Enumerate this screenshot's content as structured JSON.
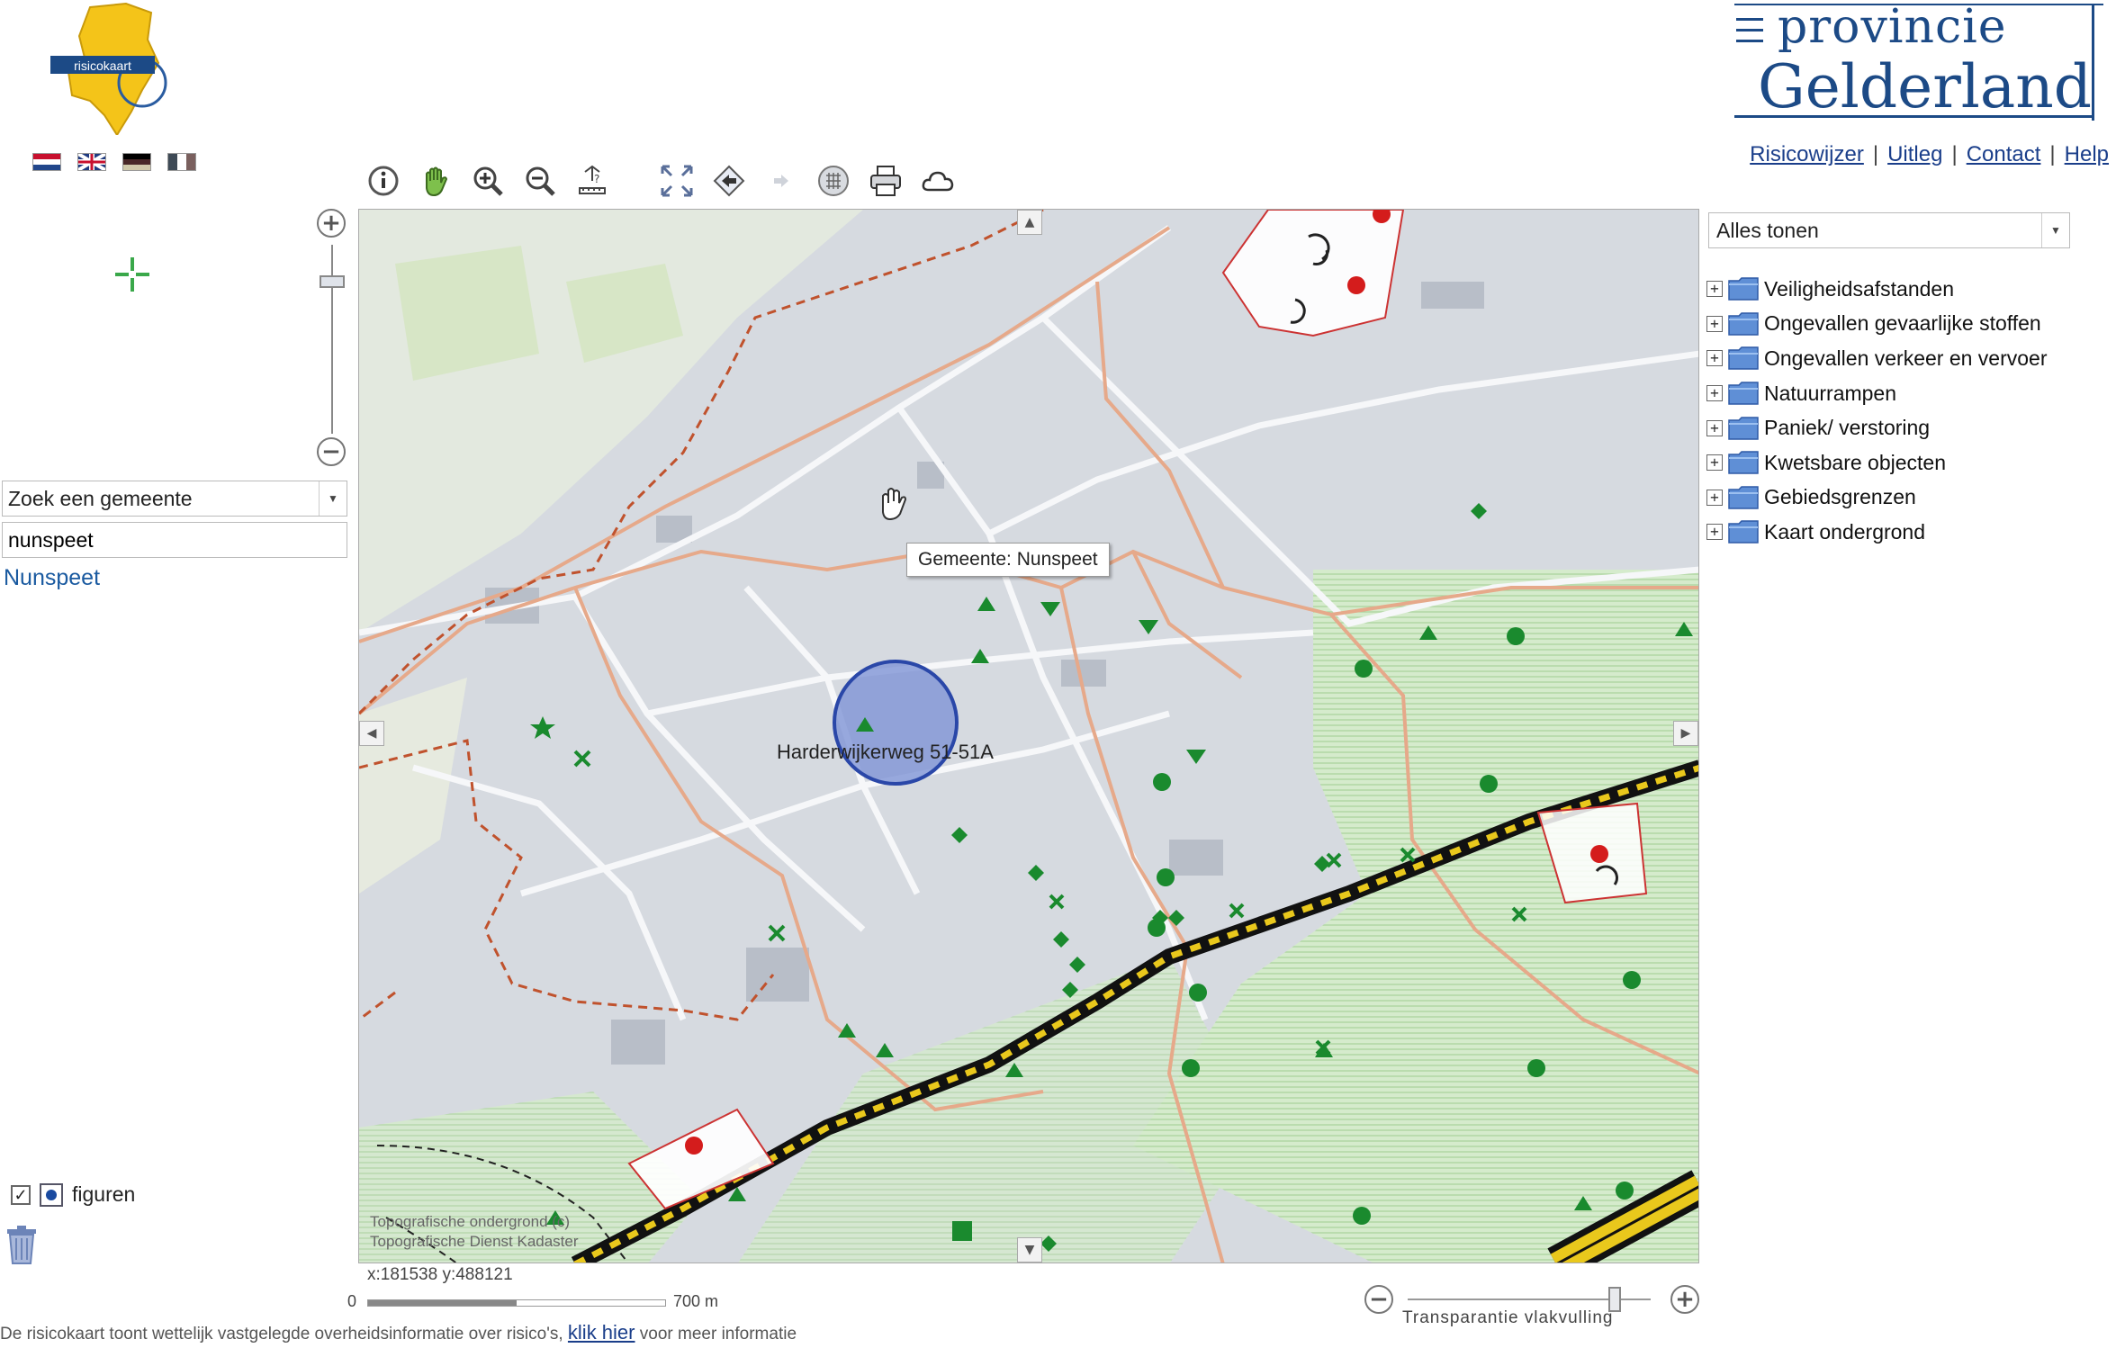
{
  "header": {
    "logo_text": "risicokaart",
    "brand_line1": "provincie",
    "brand_line2": "Gelderland",
    "links": [
      "Risicowijzer",
      "Uitleg",
      "Contact",
      "Help"
    ],
    "language_flags": [
      "nl-flag-icon",
      "en-flag-icon",
      "de-flag-icon",
      "fr-flag-icon"
    ]
  },
  "toolbar": {
    "tools": [
      "info-icon",
      "pan-hand-icon",
      "zoom-in-icon",
      "zoom-out-icon",
      "measure-icon",
      "full-extent-icon",
      "back-arrow-icon",
      "forward-arrow-icon",
      "grid-icon",
      "print-icon",
      "cloud-icon"
    ]
  },
  "left_panel": {
    "zoom_in": "+",
    "zoom_out": "−",
    "gemeente_select": "Zoek een gemeente",
    "search_value": "nunspeet",
    "result": "Nunspeet",
    "figuren_label": "figuren"
  },
  "map": {
    "tooltip": "Gemeente: Nunspeet",
    "address_label": "Harderwijkerweg 51-51A",
    "attribution_line1": "Topografische ondergrond (c)",
    "attribution_line2": "Topografische Dienst Kadaster",
    "coordinates": "x:181538 y:488121",
    "scale_start": "0",
    "scale_end": "700 m",
    "colors": {
      "marker_green": "#1a8a2e",
      "risk_red": "#d41c1c",
      "municipal_border": "#c0522d",
      "highlight_circle": "#7f94d6"
    }
  },
  "transparency": {
    "label": "Transparantie vlakvulling",
    "minus": "−",
    "plus": "+",
    "level": 0.85
  },
  "layers": {
    "select": "Alles tonen",
    "items": [
      "Veiligheidsafstanden",
      "Ongevallen gevaarlijke stoffen",
      "Ongevallen verkeer en vervoer",
      "Natuurrampen",
      "Paniek/ verstoring",
      "Kwetsbare objecten",
      "Gebiedsgrenzen",
      "Kaart ondergrond"
    ]
  },
  "footer": {
    "text_before": "De risicokaart toont wettelijk vastgelegde overheidsinformatie over risico's,",
    "link": "klik hier",
    "text_after": "voor meer informatie"
  }
}
